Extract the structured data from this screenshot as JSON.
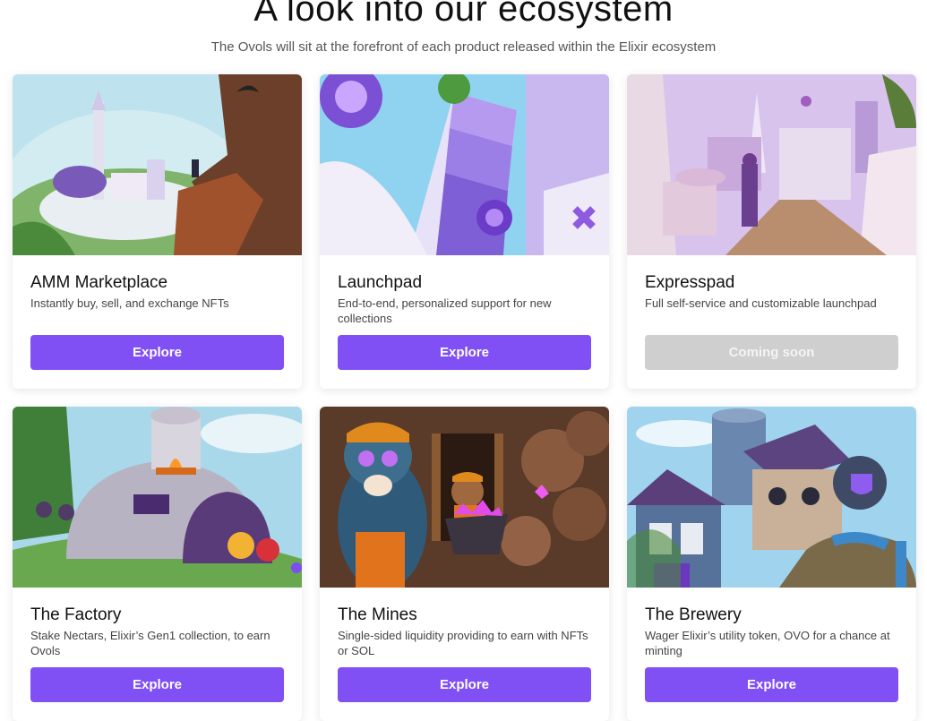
{
  "header": {
    "title": "A look into our ecosystem",
    "subtitle": "The Ovols will sit at the forefront of each product released within the Elixir ecosystem"
  },
  "colors": {
    "accent": "#8050F5",
    "disabled": "#CFCFCF"
  },
  "cards": [
    {
      "title": "AMM Marketplace",
      "description": "Instantly buy, sell, and exchange NFTs",
      "button_label": "Explore",
      "button_enabled": true,
      "image": "floating-city-illustration"
    },
    {
      "title": "Launchpad",
      "description": "End-to-end, personalized support for new collections",
      "button_label": "Explore",
      "button_enabled": true,
      "image": "crystal-tower-illustration"
    },
    {
      "title": "Expresspad",
      "description": "Full self-service and customizable launchpad",
      "button_label": "Coming soon",
      "button_enabled": false,
      "image": "pink-street-illustration"
    },
    {
      "title": "The Factory",
      "description": "Stake Nectars, Elixir’s Gen1 collection, to earn Ovols",
      "button_label": "Explore",
      "button_enabled": true,
      "image": "furnace-dome-illustration"
    },
    {
      "title": "The Mines",
      "description": "Single-sided liquidity providing to earn with NFTs or SOL",
      "button_label": "Explore",
      "button_enabled": true,
      "image": "miner-apes-illustration"
    },
    {
      "title": "The Brewery",
      "description": "Wager Elixir’s utility token, OVO for a chance at minting",
      "button_label": "Explore",
      "button_enabled": true,
      "image": "brewery-building-illustration"
    }
  ]
}
